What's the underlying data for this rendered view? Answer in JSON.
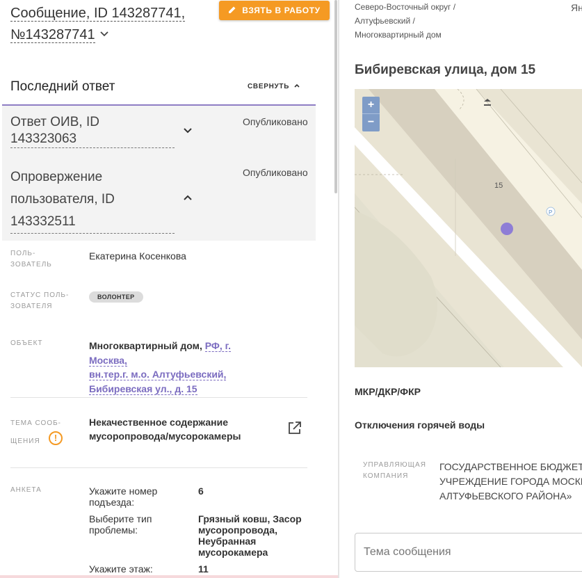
{
  "message": {
    "title_line1": "Сообщение, ID 143287741,",
    "title_line2": "№143287741",
    "take_button": "ВЗЯТЬ В РАБОТУ"
  },
  "last_answer": {
    "heading": "Последний ответ",
    "collapse_label": "СВЕРНУТЬ",
    "answers": [
      {
        "title_line1": "Ответ ОИВ, ID",
        "title_line2": "143323063",
        "status": "Опубликовано"
      },
      {
        "title_line1": "Опровержение",
        "title_line2": "пользователя, ID",
        "title_line3": "143332511",
        "status": "Опубликовано"
      }
    ]
  },
  "details": {
    "user_label_1": "ПОЛЬ-",
    "user_label_2": "ЗОВАТЕЛЬ",
    "user_value": "Екатерина Косенкова",
    "status_label_1": "СТАТУС ПОЛЬ-",
    "status_label_2": "ЗОВАТЕЛЯ",
    "status_value": "ВОЛОНТЕР",
    "object_label": "ОБЪЕКТ",
    "object_type": "Многоквартирный дом, ",
    "object_link_1": "РФ, г. Москва,",
    "object_link_2": "вн.тер.г. м.о. Алтуфьевский,",
    "object_link_3": "Бибиревская ул., д. 15",
    "topic_label_1": "ТЕМА СООБ-",
    "topic_label_2": "ЩЕНИЯ",
    "topic_value": "Некачественное содержание мусоропровода/мусорокамеры",
    "warn_symbol": "!",
    "survey_label": "АНКЕТА",
    "survey": [
      {
        "q": "Укажите номер подъезда:",
        "a": "6"
      },
      {
        "q": "Выберите тип проблемы:",
        "a": "Грязный ковш, Засор мусоропровода, Неубранная мусорокамера"
      },
      {
        "q": "Укажите этаж:",
        "a": "11"
      }
    ]
  },
  "right": {
    "breadcrumb_1": "Северо-Восточный округ /",
    "breadcrumb_2": "Алтуфьевский /",
    "breadcrumb_3": "Многоквартирный дом",
    "yandex_fragment": "Ян",
    "address": "Бибиревская улица, дом 15",
    "map": {
      "zoom_in": "+",
      "zoom_out": "−",
      "house_number": "15",
      "parking_label": "P"
    },
    "category": "МКР/ДКР/ФКР",
    "subcategory": "Отключения горячей воды",
    "mc_label_1": "УПРАВЛЯЮЩАЯ",
    "mc_label_2": "КОМПАНИЯ",
    "mc_value_1": "ГОСУДАРСТВЕННОЕ БЮДЖЕТНОЕ",
    "mc_value_2": "УЧРЕЖДЕНИЕ ГОРОДА МОСКВЫ",
    "mc_value_3": "АЛТУФЬЕВСКОГО РАЙОНА»",
    "topic_placeholder": "Тема сообщения"
  },
  "colors": {
    "accent_orange": "#f59a23",
    "link_purple": "#7b6cc0",
    "map_marker": "#8e7dd6"
  }
}
